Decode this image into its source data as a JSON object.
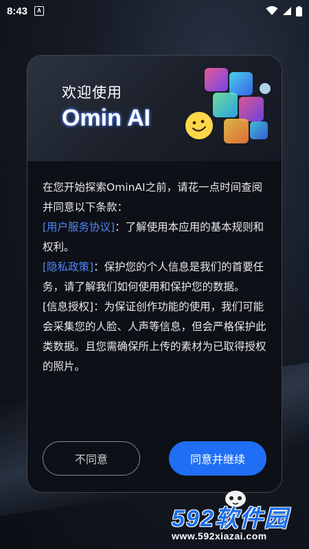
{
  "status_bar": {
    "time": "8:43",
    "notification_icon": "a-icon",
    "wifi_icon": "wifi-icon",
    "signal_icon": "signal-icon",
    "battery_icon": "battery-icon"
  },
  "dialog": {
    "subtitle": "欢迎使用",
    "title": "Omin AI",
    "intro": "在您开始探索OminAI之前，请花一点时间查阅并同意以下条款：",
    "terms_link": "[用户服务协议]",
    "terms_desc": "：了解使用本应用的基本规则和权利。",
    "privacy_link": "[隐私政策]",
    "privacy_desc": "：保护您的个人信息是我们的首要任务，请了解我们如何使用和保护您的数据。",
    "authorization": "[信息授权]：为保证创作功能的使用，我们可能会采集您的人脸、人声等信息，但会严格保护此类数据。且您需确保所上传的素材为已取得授权的照片。",
    "decline_label": "不同意",
    "accept_label": "同意并继续"
  },
  "watermark": {
    "brand": "592软件园",
    "url": "www.592xiazai.com"
  },
  "colors": {
    "accent": "#1f6ef5",
    "link": "#4f86ff"
  }
}
